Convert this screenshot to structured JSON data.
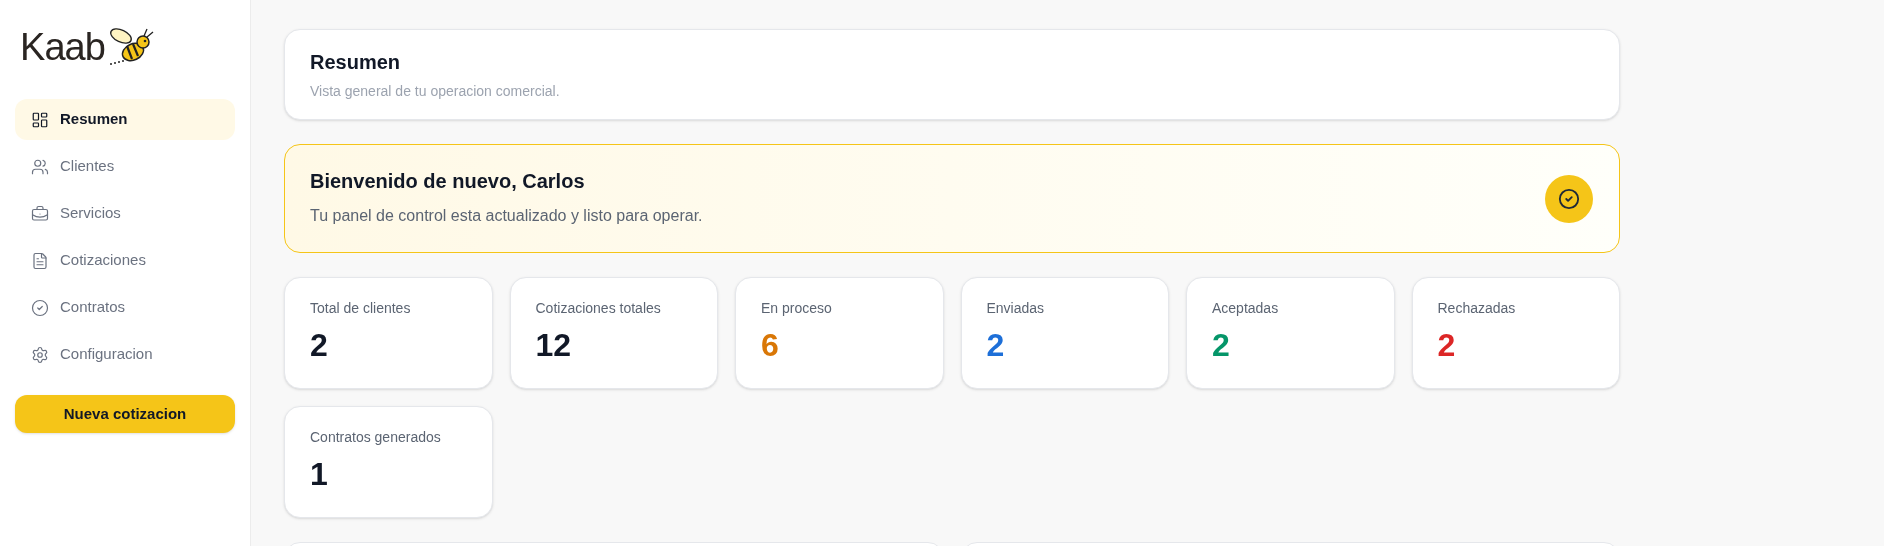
{
  "sidebar": {
    "logo": "Kaab",
    "items": [
      {
        "label": "Resumen",
        "selected": true
      },
      {
        "label": "Clientes",
        "selected": false
      },
      {
        "label": "Servicios",
        "selected": false
      },
      {
        "label": "Cotizaciones",
        "selected": false
      },
      {
        "label": "Contratos",
        "selected": false
      },
      {
        "label": "Configuracion",
        "selected": false
      }
    ],
    "button": "Nueva cotizacion"
  },
  "header": {
    "title": "Resumen",
    "subtitle": "Vista general de tu operacion comercial."
  },
  "welcome": {
    "title": "Bienvenido de nuevo, Carlos",
    "message": "Tu panel de control esta actualizado y listo para operar."
  },
  "stats": [
    {
      "label": "Total de clientes",
      "value": "2",
      "color": "#111827"
    },
    {
      "label": "Cotizaciones totales",
      "value": "12",
      "color": "#111827"
    },
    {
      "label": "En proceso",
      "value": "6",
      "color": "#d97706"
    },
    {
      "label": "Enviadas",
      "value": "2",
      "color": "#1d6fd8"
    },
    {
      "label": "Aceptadas",
      "value": "2",
      "color": "#059669"
    },
    {
      "label": "Rechazadas",
      "value": "2",
      "color": "#dc2626"
    },
    {
      "label": "Contratos generados",
      "value": "1",
      "color": "#111827"
    }
  ]
}
